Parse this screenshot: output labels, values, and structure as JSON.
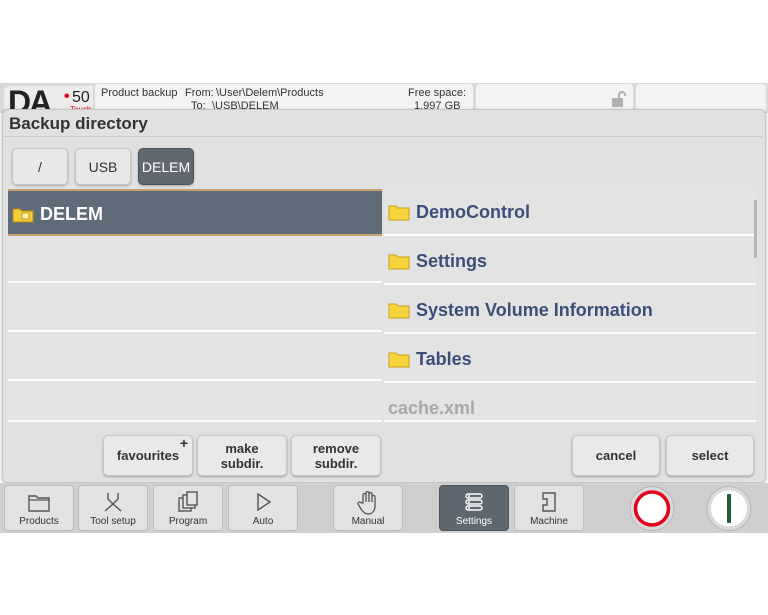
{
  "header": {
    "logo": {
      "text": "DA",
      "dot": "•",
      "number": "50",
      "sub": "Touch"
    },
    "info": {
      "mode": "Product backup",
      "from_label": "From:",
      "from_path": "\\User\\Delem\\Products",
      "to_label": "To:",
      "to_path": "\\USB\\DELEM",
      "free_space_label": "Free space:",
      "free_space_value": "1.997 GB"
    },
    "lock_icon": "unlock-icon"
  },
  "dialog": {
    "title": "Backup directory",
    "path_buttons": [
      "/",
      "USB",
      "DELEM"
    ],
    "active_path": "DELEM",
    "left_list": {
      "items": [
        "DELEM",
        "",
        "",
        "",
        ""
      ],
      "selected": "DELEM"
    },
    "right_list": {
      "items": [
        {
          "label": "DemoControl",
          "type": "folder"
        },
        {
          "label": "Settings",
          "type": "folder"
        },
        {
          "label": "System Volume Information",
          "type": "folder"
        },
        {
          "label": "Tables",
          "type": "folder"
        },
        {
          "label": "cache.xml",
          "type": "file"
        }
      ]
    },
    "buttons": {
      "favourites": "favourites",
      "favourites_plus": "+",
      "make_subdir_1": "make",
      "make_subdir_2": "subdir.",
      "remove_subdir_1": "remove",
      "remove_subdir_2": "subdir.",
      "cancel": "cancel",
      "select": "select"
    }
  },
  "bottom_nav": {
    "tabs": [
      {
        "label": "Products",
        "icon": "products-icon"
      },
      {
        "label": "Tool setup",
        "icon": "tool-setup-icon"
      },
      {
        "label": "Program",
        "icon": "program-icon"
      },
      {
        "label": "Auto",
        "icon": "play-icon"
      },
      {
        "label": "Manual",
        "icon": "hand-icon"
      },
      {
        "label": "Settings",
        "icon": "settings-list-icon"
      },
      {
        "label": "Machine",
        "icon": "machine-icon"
      }
    ],
    "active_tab": "Settings",
    "stop_icon": "stop-icon",
    "start_icon": "start-icon"
  },
  "colors": {
    "selected_row": "#5e6b78",
    "folder_text": "#3b4f7a",
    "file_text": "#a8a8a8",
    "stop_red": "#e2001a",
    "start_green": "#1f5c3a"
  }
}
